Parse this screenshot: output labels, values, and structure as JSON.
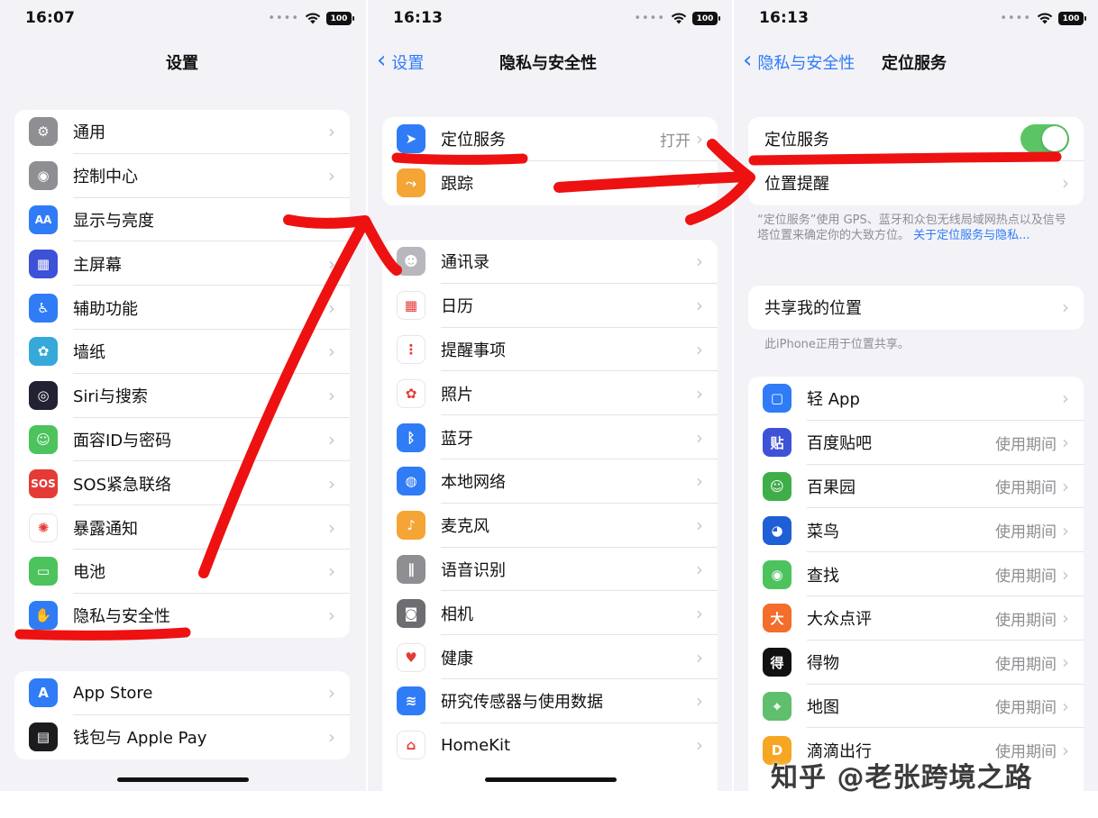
{
  "panel1": {
    "time": "16:07",
    "battery": "100",
    "title": "设置",
    "items": [
      {
        "label": "通用",
        "icon": "gear-icon",
        "color": "#8e8e93",
        "glyph": "⚙"
      },
      {
        "label": "控制中心",
        "icon": "control-center-icon",
        "color": "#8e8e93",
        "glyph": "◉"
      },
      {
        "label": "显示与亮度",
        "icon": "display-brightness-icon",
        "color": "#2f7cf6",
        "glyph": "AA"
      },
      {
        "label": "主屏幕",
        "icon": "home-screen-icon",
        "color": "#3d52d6",
        "glyph": "▦"
      },
      {
        "label": "辅助功能",
        "icon": "accessibility-icon",
        "color": "#2f7cf6",
        "glyph": "♿"
      },
      {
        "label": "墙纸",
        "icon": "wallpaper-icon",
        "color": "#36a9d9",
        "glyph": "✿"
      },
      {
        "label": "Siri与搜索",
        "icon": "siri-icon",
        "color": "#222233",
        "glyph": "◎"
      },
      {
        "label": "面容ID与密码",
        "icon": "face-id-icon",
        "color": "#4cc35c",
        "glyph": "☺"
      },
      {
        "label": "SOS紧急联络",
        "icon": "sos-icon",
        "color": "#e53b35",
        "glyph": "SOS"
      },
      {
        "label": "暴露通知",
        "icon": "exposure-notification-icon",
        "color": "#ffffff",
        "glyph": "✺"
      },
      {
        "label": "电池",
        "icon": "battery-icon",
        "color": "#4cc35c",
        "glyph": "▭"
      },
      {
        "label": "隐私与安全性",
        "icon": "privacy-hand-icon",
        "color": "#2f7cf6",
        "glyph": "✋"
      }
    ],
    "items2": [
      {
        "label": "App Store",
        "icon": "app-store-icon",
        "color": "#2f7cf6",
        "glyph": "A"
      },
      {
        "label": "钱包与 Apple Pay",
        "icon": "wallet-icon",
        "color": "#1c1c1e",
        "glyph": "▤"
      }
    ]
  },
  "panel2": {
    "time": "16:13",
    "battery": "100",
    "back_label": "设置",
    "title": "隐私与安全性",
    "top_items": [
      {
        "label": "定位服务",
        "icon": "location-arrow-icon",
        "color": "#2f7cf6",
        "glyph": "➤",
        "value": "打开"
      },
      {
        "label": "跟踪",
        "icon": "tracking-icon",
        "color": "#f4a535",
        "glyph": "⤳",
        "value": ""
      }
    ],
    "items": [
      {
        "label": "通讯录",
        "icon": "contacts-icon",
        "color": "#b7b7bd",
        "glyph": "☻"
      },
      {
        "label": "日历",
        "icon": "calendar-icon",
        "color": "#ffffff",
        "glyph": "▦"
      },
      {
        "label": "提醒事项",
        "icon": "reminders-icon",
        "color": "#ffffff",
        "glyph": "⋮"
      },
      {
        "label": "照片",
        "icon": "photos-icon",
        "color": "#ffffff",
        "glyph": "✿"
      },
      {
        "label": "蓝牙",
        "icon": "bluetooth-icon",
        "color": "#2f7cf6",
        "glyph": "ᛒ"
      },
      {
        "label": "本地网络",
        "icon": "local-network-icon",
        "color": "#2f7cf6",
        "glyph": "◍"
      },
      {
        "label": "麦克风",
        "icon": "microphone-icon",
        "color": "#f4a535",
        "glyph": "♪"
      },
      {
        "label": "语音识别",
        "icon": "speech-recognition-icon",
        "color": "#8e8e93",
        "glyph": "∥"
      },
      {
        "label": "相机",
        "icon": "camera-icon",
        "color": "#6d6d72",
        "glyph": "◙"
      },
      {
        "label": "健康",
        "icon": "health-heart-icon",
        "color": "#ffffff",
        "glyph": "♥"
      },
      {
        "label": "研究传感器与使用数据",
        "icon": "research-sensor-icon",
        "color": "#2f7cf6",
        "glyph": "≋"
      },
      {
        "label": "HomeKit",
        "icon": "homekit-icon",
        "color": "#ffffff",
        "glyph": "⌂"
      }
    ]
  },
  "panel3": {
    "time": "16:13",
    "battery": "100",
    "back_label": "隐私与安全性",
    "title": "定位服务",
    "location_services_label": "定位服务",
    "location_alerts_label": "位置提醒",
    "footnote_text": "“定位服务”使用 GPS、蓝牙和众包无线局域网热点以及信号塔位置来确定你的大致方位。",
    "footnote_link": "关于定位服务与隐私...",
    "share_label": "共享我的位置",
    "share_note": "此iPhone正用于位置共享。",
    "apps": [
      {
        "label": "轻 App",
        "icon": "light-app-icon",
        "color": "#2f7cf6",
        "glyph": "▢",
        "value": ""
      },
      {
        "label": "百度贴吧",
        "icon": "baidu-tieba-icon",
        "color": "#3d52d6",
        "glyph": "贴",
        "value": "使用期间"
      },
      {
        "label": "百果园",
        "icon": "baiguoyuan-icon",
        "color": "#3fae49",
        "glyph": "☺",
        "value": "使用期间"
      },
      {
        "label": "菜鸟",
        "icon": "cainiao-icon",
        "color": "#1f5fd6",
        "glyph": "◕",
        "value": "使用期间"
      },
      {
        "label": "查找",
        "icon": "find-my-icon",
        "color": "#4cc35c",
        "glyph": "◉",
        "value": "使用期间"
      },
      {
        "label": "大众点评",
        "icon": "dianping-icon",
        "color": "#f36d2b",
        "glyph": "大",
        "value": "使用期间"
      },
      {
        "label": "得物",
        "icon": "dewu-icon",
        "color": "#111111",
        "glyph": "得",
        "value": "使用期间"
      },
      {
        "label": "地图",
        "icon": "maps-icon",
        "color": "#5fbf6c",
        "glyph": "⌖",
        "value": "使用期间"
      },
      {
        "label": "滴滴出行",
        "icon": "didi-icon",
        "color": "#f5a623",
        "glyph": "D",
        "value": "使用期间"
      }
    ]
  },
  "watermark": "知乎 @老张跨境之路"
}
